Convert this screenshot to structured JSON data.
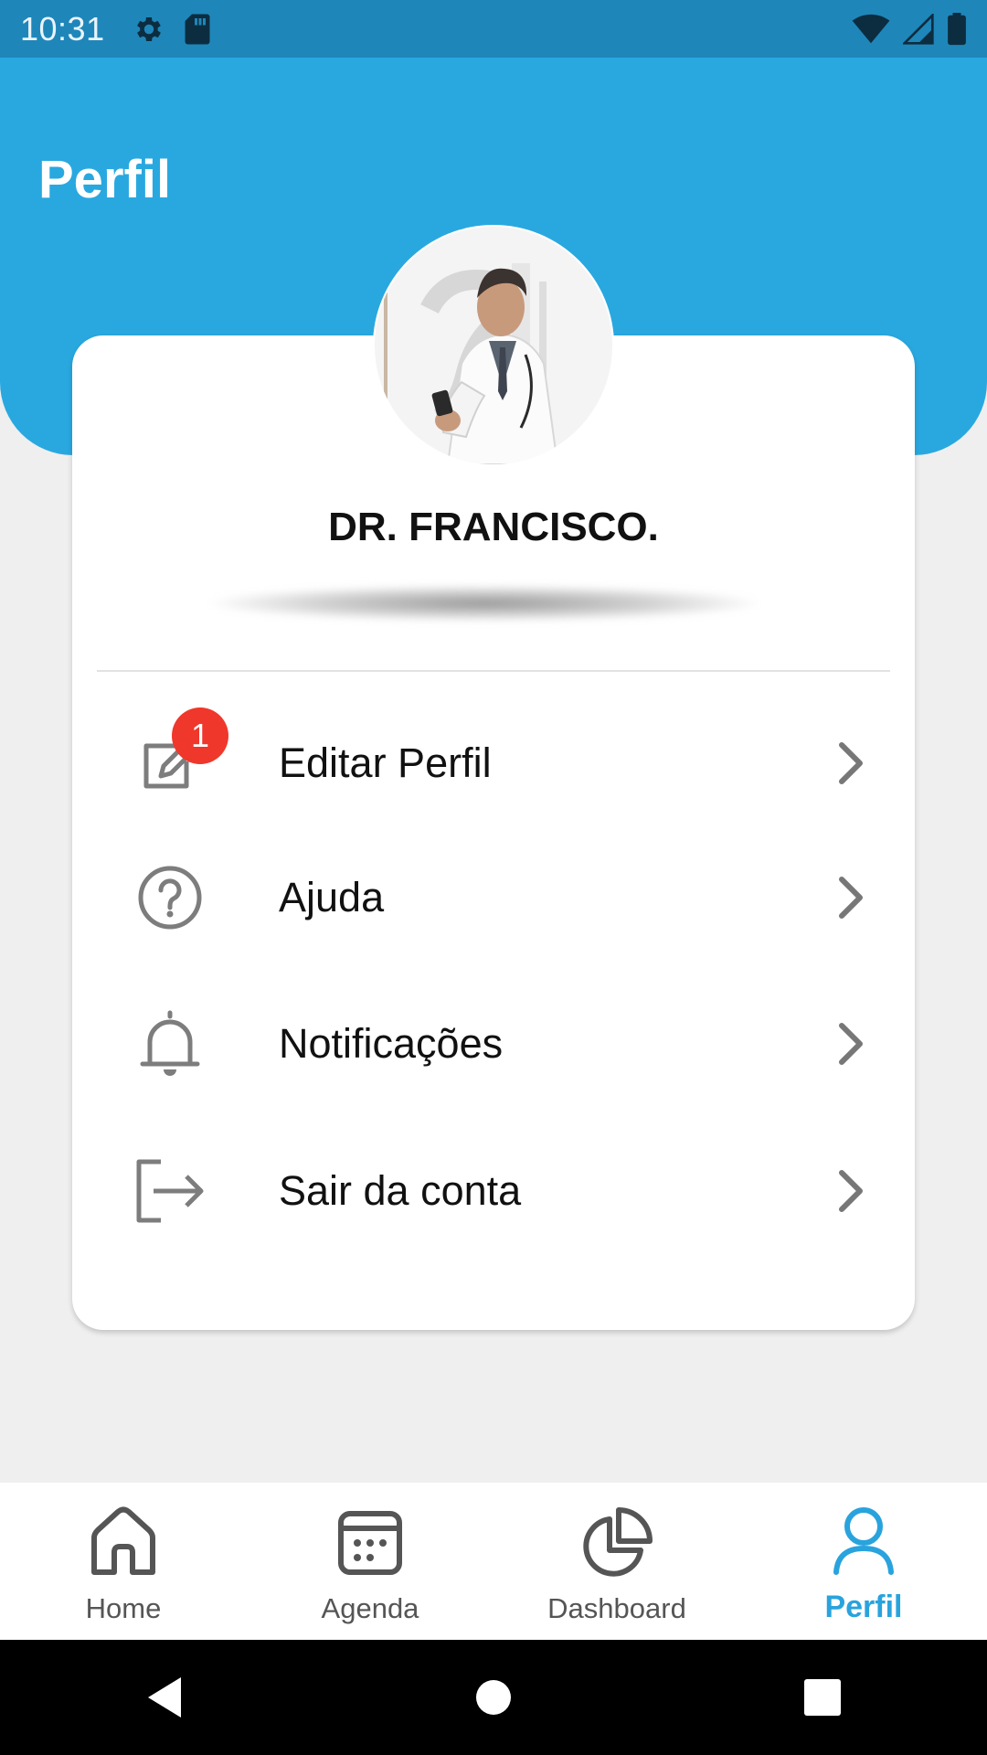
{
  "status_bar": {
    "time": "10:31",
    "left_icons": [
      "gear-icon",
      "sd-card-icon"
    ],
    "right_icons": [
      "wifi-icon",
      "cell-signal-icon",
      "battery-icon"
    ]
  },
  "header": {
    "title": "Perfil",
    "color": "#29a8e0"
  },
  "profile": {
    "name": "DR. FRANCISCO.",
    "avatar_icon": "doctor-photo"
  },
  "menu": {
    "items": [
      {
        "label": "Editar Perfil",
        "icon": "edit-icon",
        "badge": "1"
      },
      {
        "label": "Ajuda",
        "icon": "help-icon"
      },
      {
        "label": "Notificações",
        "icon": "bell-icon"
      },
      {
        "label": "Sair da conta",
        "icon": "logout-icon"
      }
    ]
  },
  "bottom_nav": {
    "items": [
      {
        "label": "Home",
        "icon": "home-icon"
      },
      {
        "label": "Agenda",
        "icon": "calendar-icon"
      },
      {
        "label": "Dashboard",
        "icon": "pie-chart-icon"
      },
      {
        "label": "Perfil",
        "icon": "user-icon",
        "active": true
      }
    ],
    "active_color": "#29a3dd"
  },
  "system_nav": [
    "back-icon",
    "home-circle-icon",
    "recents-icon"
  ]
}
